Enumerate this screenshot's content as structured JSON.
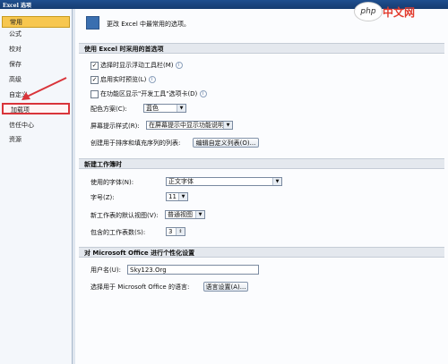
{
  "window": {
    "title": "Excel 选项"
  },
  "logo": {
    "bubble": "php",
    "text": "中文网"
  },
  "sidebar": {
    "items": [
      {
        "label": "常用"
      },
      {
        "label": "公式"
      },
      {
        "label": "校对"
      },
      {
        "label": "保存"
      },
      {
        "label": "高级"
      },
      {
        "label": "自定义"
      },
      {
        "label": "加载项"
      },
      {
        "label": "信任中心"
      },
      {
        "label": "资源"
      }
    ]
  },
  "header": {
    "text": "更改 Excel 中最常用的选项。"
  },
  "sections": {
    "top": "使用 Excel 时采用的首选项",
    "new_wb": "新建工作簿时",
    "personalize": "对 Microsoft Office 进行个性化设置"
  },
  "options": {
    "floatie": "选择时显示浮动工具栏(M)",
    "live_preview": "启用实时预览(L)",
    "dev_tab": "在功能区显示\"开发工具\"选项卡(D)",
    "color_scheme_label": "配色方案(C):",
    "color_scheme_value": "蓝色",
    "screentip_label": "屏幕提示样式(R):",
    "screentip_value": "在屏幕提示中显示功能说明",
    "custom_lists_label": "创建用于排序和填充序列的列表:",
    "custom_lists_button": "编辑自定义列表(O)..."
  },
  "new_workbook": {
    "font_label": "使用的字体(N):",
    "font_value": "正文字体",
    "size_label": "字号(Z):",
    "size_value": "11",
    "view_label": "新工作表的默认视图(V):",
    "view_value": "普通视图",
    "sheets_label": "包含的工作表数(S):",
    "sheets_value": "3"
  },
  "personal": {
    "username_label": "用户名(U):",
    "username_value": "Sky123.Org",
    "language_label": "选择用于 Microsoft Office 的语言:",
    "language_button": "语言设置(A)..."
  }
}
